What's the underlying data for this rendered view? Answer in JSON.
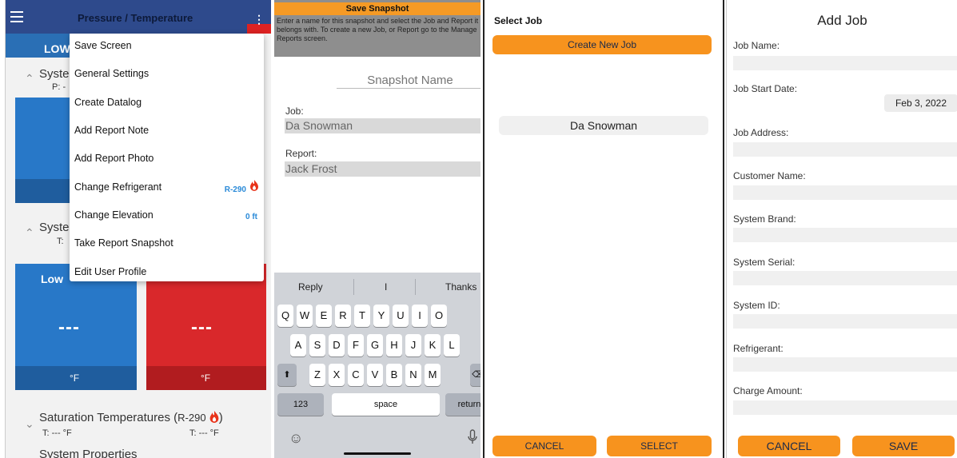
{
  "colors": {
    "header_blue": "#2e4a8c",
    "low_blue": "#2878c8",
    "high_red": "#d9282b",
    "accent_orange": "#f7931e",
    "value_blue": "#2a8ad8"
  },
  "panel1": {
    "title": "Pressure / Temperature",
    "low_tab": "LOW",
    "system1_label": "Syste",
    "system1_sub": "P: -",
    "system2_label": "Syste",
    "system2_sub": "T:",
    "low_temp_title": "Low",
    "low_temp_value": "---",
    "high_temp_value": "---",
    "low_unit": "°F",
    "high_unit": "°F",
    "saturation_title": "Saturation Temperatures (",
    "saturation_refrigerant": "R-290",
    "saturation_close": ")",
    "sat_left": "T: --- °F",
    "sat_right": "T: --- °F",
    "system_properties": "System Properties",
    "menu": [
      {
        "label": "Save Screen"
      },
      {
        "label": "General Settings"
      },
      {
        "label": "Create Datalog"
      },
      {
        "label": "Add Report Note"
      },
      {
        "label": "Add Report Photo"
      },
      {
        "label": "Change Refrigerant",
        "value": "R-290"
      },
      {
        "label": "Change Elevation",
        "value": "0 ft"
      },
      {
        "label": "Take Report Snapshot"
      },
      {
        "label": "Edit User Profile"
      }
    ]
  },
  "panel2": {
    "title": "Save Snapshot",
    "description": "Enter a name for this snapshot and select the Job and Report it belongs with. To create a new Job, or Report go to the Manage Reports screen.",
    "snapshot_placeholder": "Snapshot Name",
    "job_label": "Job:",
    "job_value": "Da Snowman",
    "report_label": "Report:",
    "report_value": "Jack Frost",
    "suggestions": [
      "Reply",
      "I",
      "Thanks"
    ],
    "row1": [
      "Q",
      "W",
      "E",
      "R",
      "T",
      "Y",
      "U",
      "I",
      "O"
    ],
    "row2": [
      "A",
      "S",
      "D",
      "F",
      "G",
      "H",
      "J",
      "K",
      "L"
    ],
    "row3": [
      "Z",
      "X",
      "C",
      "V",
      "B",
      "N",
      "M"
    ],
    "key_123": "123",
    "key_space": "space",
    "key_return": "return"
  },
  "panel3": {
    "title": "Select Job",
    "create_button": "Create New Job",
    "job_item": "Da Snowman",
    "cancel_button": "CANCEL",
    "select_button": "SELECT"
  },
  "panel4": {
    "title": "Add Job",
    "fields": [
      "Job Name:",
      "Job Start Date:",
      "Job Address:",
      "Customer Name:",
      "System Brand:",
      "System Serial:",
      "System ID:",
      "Refrigerant:",
      "Charge Amount:"
    ],
    "start_date": "Feb 3, 2022",
    "cancel_button": "CANCEL",
    "save_button": "SAVE"
  }
}
